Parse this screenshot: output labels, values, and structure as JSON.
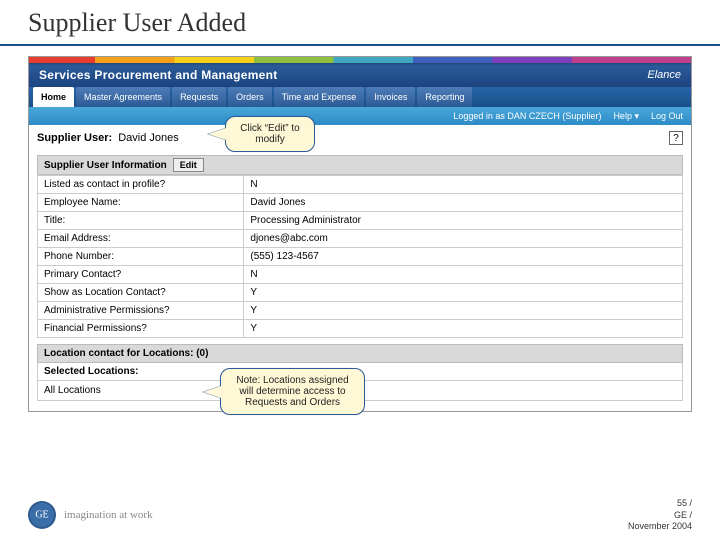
{
  "slide": {
    "title": "Supplier User Added"
  },
  "brand": {
    "title": "Services Procurement and Management",
    "vendor": "Elance"
  },
  "tabs": [
    {
      "label": "Home",
      "active": true
    },
    {
      "label": "Master Agreements"
    },
    {
      "label": "Requests"
    },
    {
      "label": "Orders"
    },
    {
      "label": "Time and Expense"
    },
    {
      "label": "Invoices"
    },
    {
      "label": "Reporting"
    }
  ],
  "userbar": {
    "logged_in": "Logged in as DAN CZECH (Supplier)",
    "help": "Help ▾",
    "logout": "Log Out"
  },
  "page": {
    "label": "Supplier User:",
    "value": "David Jones",
    "help_icon": "?"
  },
  "section_info": {
    "title": "Supplier User Information",
    "edit_btn": "Edit"
  },
  "fields": [
    {
      "k": "Listed as contact in profile?",
      "v": "N"
    },
    {
      "k": "Employee Name:",
      "v": "David Jones"
    },
    {
      "k": "Title:",
      "v": "Processing Administrator"
    },
    {
      "k": "Email Address:",
      "v": "djones@abc.com"
    },
    {
      "k": "Phone Number:",
      "v": "(555) 123-4567"
    },
    {
      "k": "Primary Contact?",
      "v": "N"
    },
    {
      "k": "Show as Location Contact?",
      "v": "Y"
    },
    {
      "k": "Administrative Permissions?",
      "v": "Y"
    },
    {
      "k": "Financial Permissions?",
      "v": "Y"
    }
  ],
  "locations": {
    "heading": "Location contact for Locations: (0)",
    "subhead": "Selected Locations:",
    "value": "All Locations"
  },
  "callouts": {
    "edit": "Click “Edit” to modify",
    "locations": "Note: Locations assigned will determine access to Requests and Orders"
  },
  "footer": {
    "tagline": "imagination at work",
    "line1": "55 /",
    "line2": "GE /",
    "line3": "November 2004"
  }
}
